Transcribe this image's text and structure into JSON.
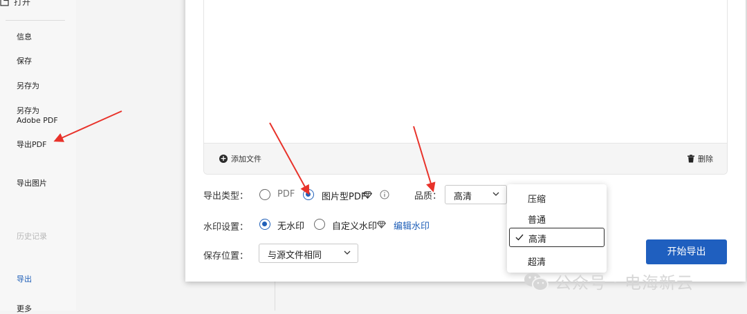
{
  "sidebar": {
    "open_label": "打开",
    "items": [
      {
        "label": "信息"
      },
      {
        "label": "保存"
      },
      {
        "label": "另存为"
      },
      {
        "label_line1": "另存为",
        "label_line2": "Adobe PDF"
      },
      {
        "label": "导出PDF"
      },
      {
        "label": "导出图片"
      },
      {
        "label": "历史记录"
      },
      {
        "label": "导出"
      },
      {
        "label": "更多"
      }
    ]
  },
  "file_panel": {
    "add_file_label": "添加文件",
    "delete_label": "删除"
  },
  "export_type": {
    "label": "导出类型：",
    "options": [
      {
        "label": "PDF",
        "checked": false
      },
      {
        "label": "图片型PDF",
        "checked": true
      }
    ]
  },
  "quality": {
    "label": "品质：",
    "selected": "高清",
    "options": [
      "压缩",
      "普通",
      "高清",
      "超清"
    ]
  },
  "watermark_setting": {
    "label": "水印设置：",
    "options": [
      {
        "label": "无水印",
        "checked": true
      },
      {
        "label": "自定义水印",
        "checked": false
      }
    ],
    "edit_link": "编辑水印"
  },
  "save_location": {
    "label": "保存位置：",
    "selected": "与源文件相同"
  },
  "start_button": "开始导出",
  "overlay_watermark": "公众号 · 电海新云",
  "colors": {
    "accent": "#1f5fbf",
    "annotation_arrow": "#e8322a"
  }
}
